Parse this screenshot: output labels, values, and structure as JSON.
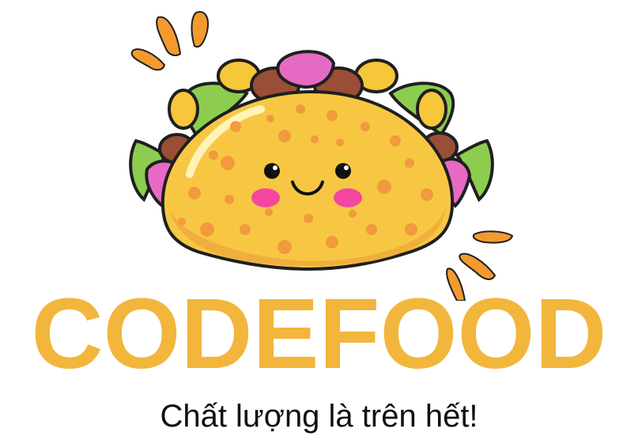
{
  "brand": {
    "name": "CODEFOOD",
    "tagline": "Chất lượng là trên hết!",
    "color": "#f2b63c",
    "tagline_color": "#111111"
  },
  "mascot": {
    "icon": "smiling-taco-icon",
    "shell_color": "#f7c744",
    "spot_color": "#f19a3e",
    "lettuce_color": "#8ccd4f",
    "meat_color": "#9a4e35",
    "onion_color": "#e56ac4",
    "cheese_color": "#f6c63b",
    "accent_color": "#f39a2f",
    "cheek_color": "#f3479f"
  }
}
